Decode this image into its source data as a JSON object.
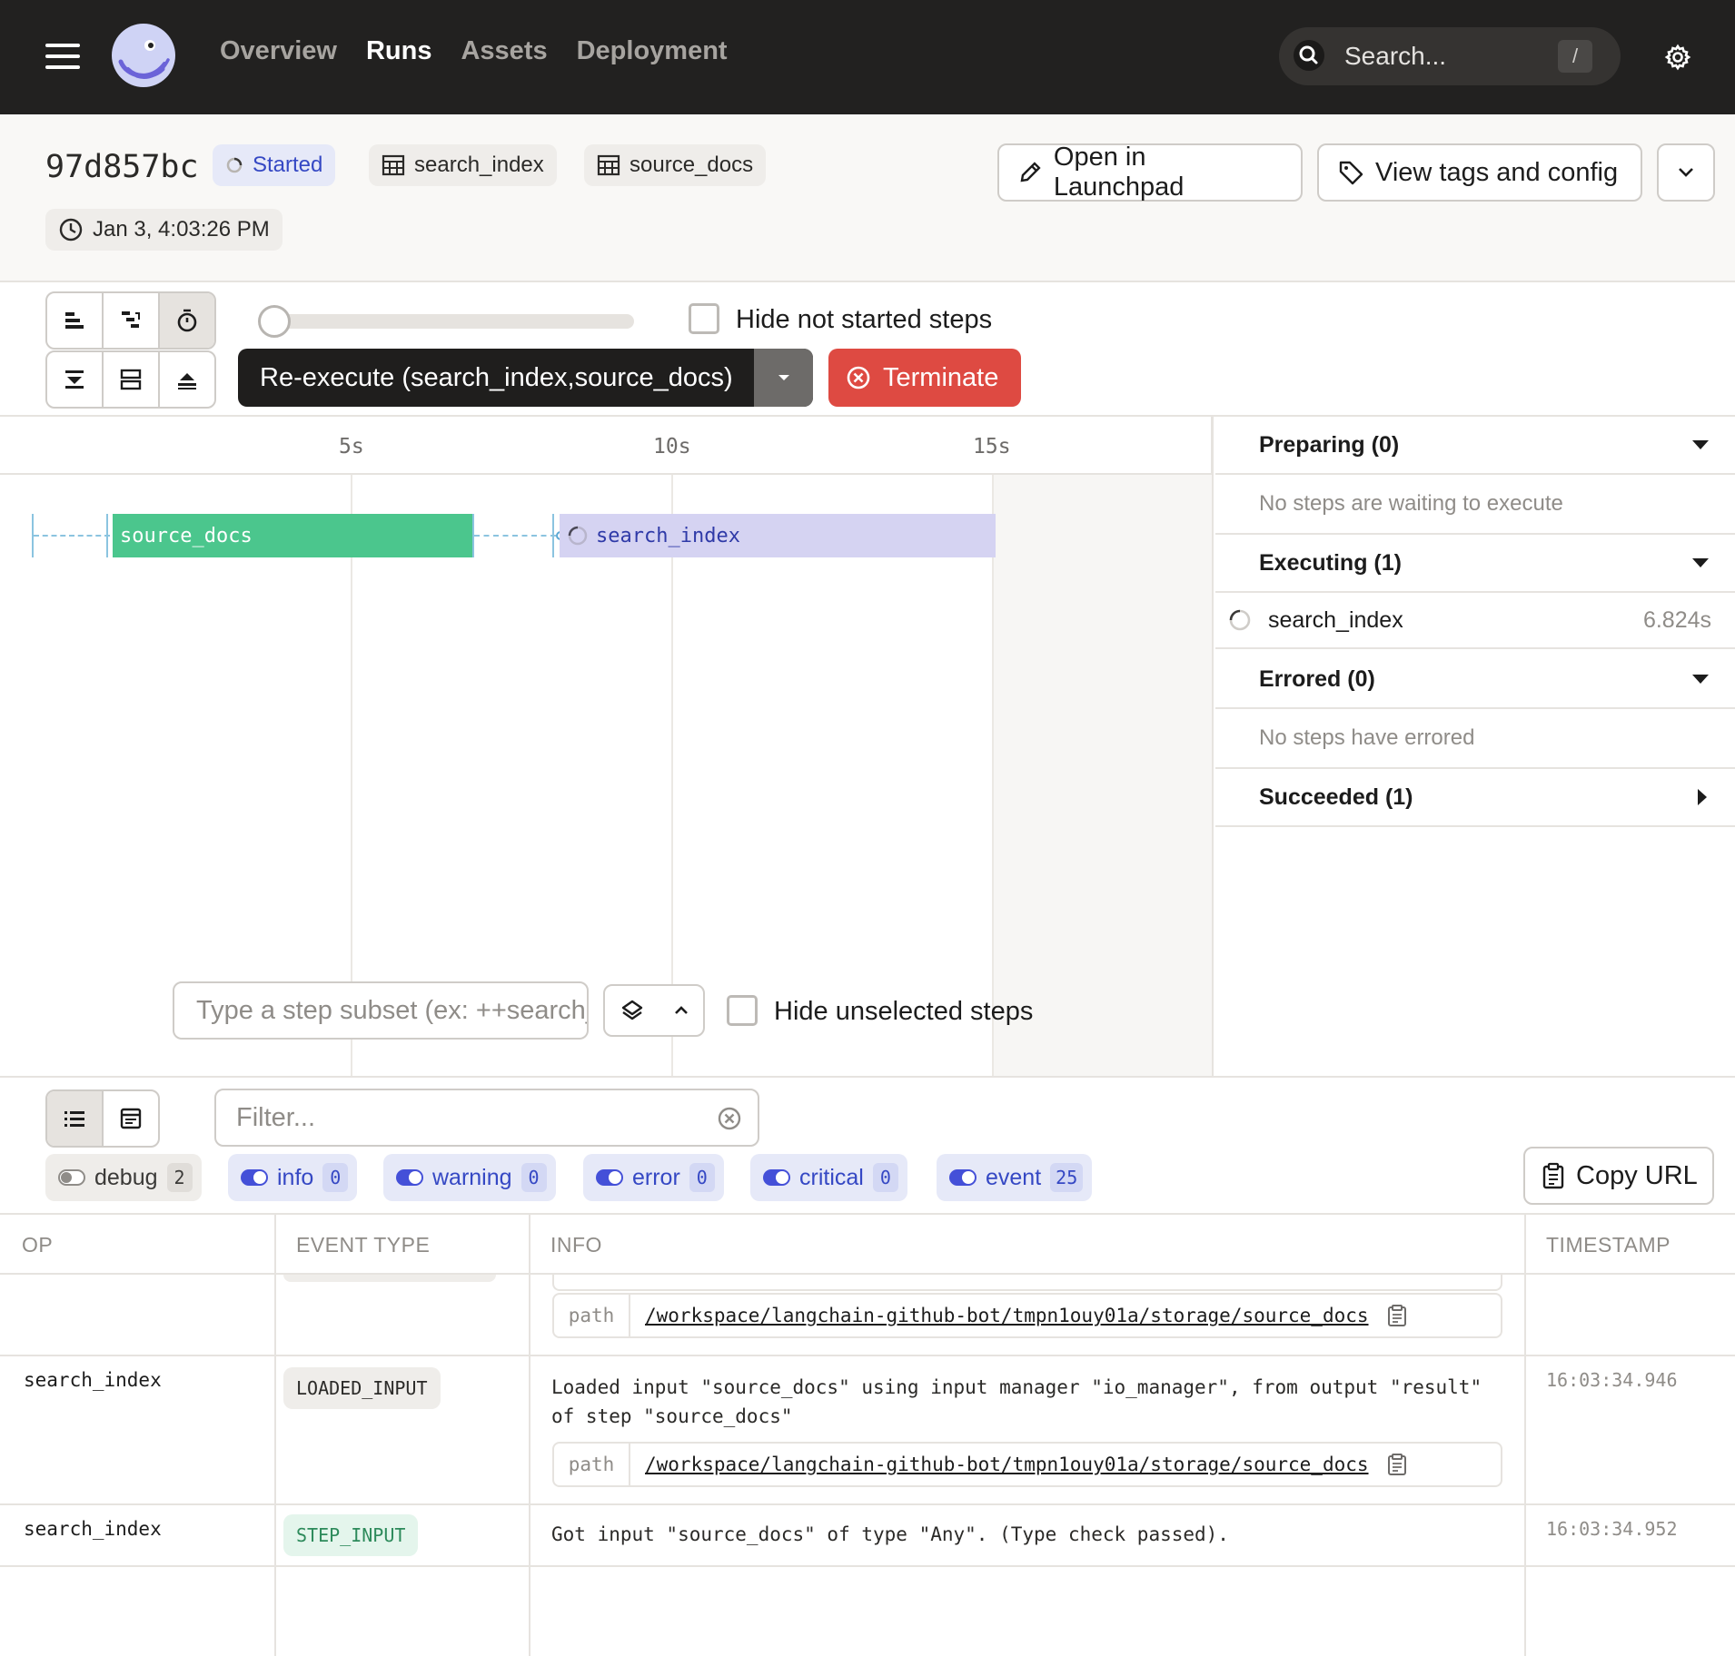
{
  "nav": {
    "links": [
      "Overview",
      "Runs",
      "Assets",
      "Deployment"
    ],
    "active": "Runs",
    "search_placeholder": "Search...",
    "search_shortcut": "/"
  },
  "header": {
    "run_id": "97d857bc",
    "status": "Started",
    "tags": [
      "search_index",
      "source_docs"
    ],
    "date": "Jan 3, 4:03:26 PM",
    "open_launchpad": "Open in Launchpad",
    "view_tags": "View tags and config"
  },
  "toolbar": {
    "hide_not_started": "Hide not started steps",
    "reexecute": "Re-execute (search_index,source_docs)",
    "terminate": "Terminate"
  },
  "gantt": {
    "ticks": [
      "5s",
      "10s",
      "15s"
    ],
    "steps": [
      {
        "name": "source_docs",
        "status": "succeeded"
      },
      {
        "name": "search_index",
        "status": "executing"
      }
    ],
    "subset_placeholder": "Type a step subset (ex: ++search_index)",
    "hide_unselected": "Hide unselected steps"
  },
  "sidebar": {
    "preparing": "Preparing (0)",
    "preparing_empty": "No steps are waiting to execute",
    "executing": "Executing (1)",
    "executing_items": [
      {
        "name": "search_index",
        "duration": "6.824s"
      }
    ],
    "errored": "Errored (0)",
    "errored_empty": "No steps have errored",
    "succeeded": "Succeeded (1)"
  },
  "logs": {
    "filter_placeholder": "Filter...",
    "levels": [
      {
        "label": "debug",
        "count": "2",
        "enabled": false
      },
      {
        "label": "info",
        "count": "0",
        "enabled": true
      },
      {
        "label": "warning",
        "count": "0",
        "enabled": true
      },
      {
        "label": "error",
        "count": "0",
        "enabled": true
      },
      {
        "label": "critical",
        "count": "0",
        "enabled": true
      },
      {
        "label": "event",
        "count": "25",
        "enabled": true
      }
    ],
    "copy_url": "Copy URL",
    "columns": [
      "OP",
      "EVENT TYPE",
      "INFO",
      "TIMESTAMP"
    ],
    "rows": [
      {
        "op": "",
        "event_type": "",
        "info": "",
        "path_key": "path",
        "path": "/workspace/langchain-github-bot/tmpn1ouy01a/storage/source_docs",
        "timestamp": ""
      },
      {
        "op": "search_index",
        "event_type": "LOADED_INPUT",
        "info_line1": "Loaded input \"source_docs\" using input manager \"io_manager\", from output \"result\"",
        "info_line2": "of step \"source_docs\"",
        "path_key": "path",
        "path": "/workspace/langchain-github-bot/tmpn1ouy01a/storage/source_docs",
        "timestamp": "16:03:34.946"
      },
      {
        "op": "search_index",
        "event_type": "STEP_INPUT",
        "info": "Got input \"source_docs\" of type \"Any\". (Type check passed).",
        "timestamp": "16:03:34.952"
      }
    ]
  },
  "colors": {
    "nav_bg": "#222120",
    "success": "#4bc68d",
    "executing": "#d5d3f2",
    "terminate": "#de4a42",
    "accent": "#4450d8"
  }
}
